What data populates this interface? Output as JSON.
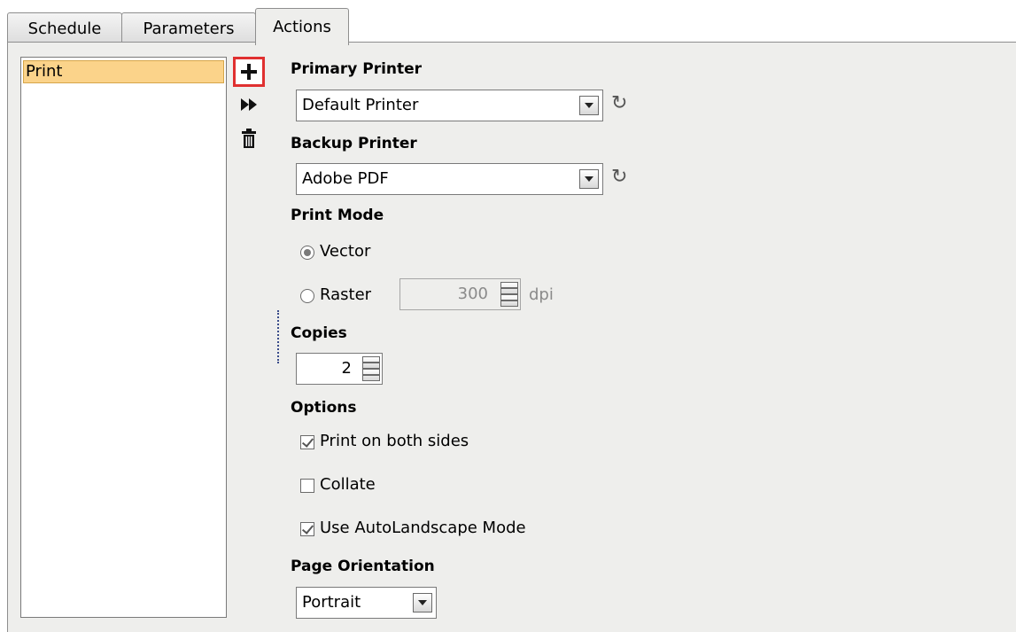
{
  "tabs": [
    {
      "label": "Schedule"
    },
    {
      "label": "Parameters"
    },
    {
      "label": "Actions"
    }
  ],
  "actions_list": {
    "items": [
      {
        "label": "Print"
      }
    ]
  },
  "toolbar": {
    "add_icon": "plus-icon",
    "run_icon": "fast-forward-icon",
    "delete_icon": "trash-icon"
  },
  "primary_printer": {
    "label": "Primary Printer",
    "value": "Default Printer"
  },
  "backup_printer": {
    "label": "Backup Printer",
    "value": "Adobe PDF"
  },
  "print_mode": {
    "label": "Print Mode",
    "options": [
      {
        "label": "Vector",
        "selected": true
      },
      {
        "label": "Raster",
        "selected": false
      }
    ],
    "dpi_value": "300",
    "dpi_unit": "dpi"
  },
  "copies": {
    "label": "Copies",
    "value": "2"
  },
  "options": {
    "label": "Options",
    "items": [
      {
        "label": "Print on both sides",
        "checked": true
      },
      {
        "label": "Collate",
        "checked": false
      },
      {
        "label": "Use AutoLandscape Mode",
        "checked": true
      }
    ]
  },
  "page_orientation": {
    "label": "Page Orientation",
    "value": "Portrait"
  },
  "colors": {
    "selection_bg": "#fbd38a",
    "highlight_border": "#e03030",
    "panel_bg": "#eeeeec"
  }
}
